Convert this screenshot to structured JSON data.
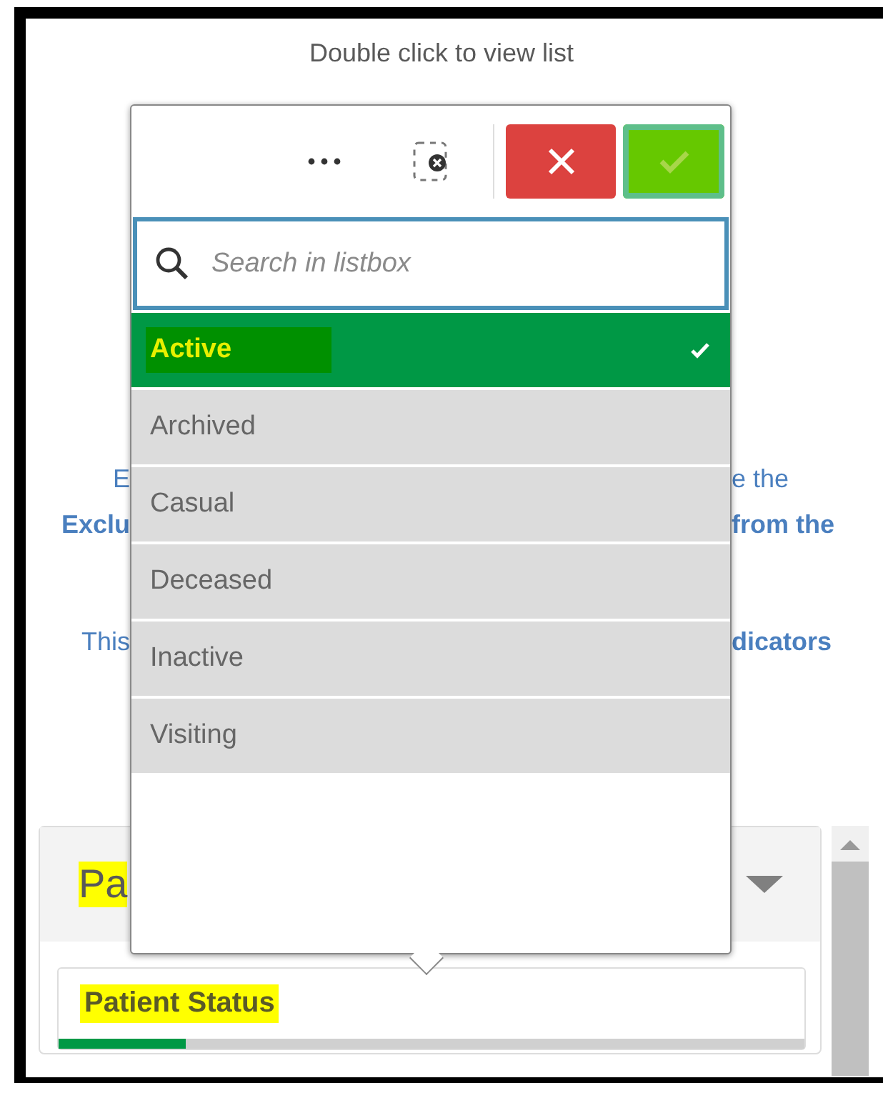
{
  "hint": "Double click to view list",
  "description_lines": [
    {
      "left": {
        "text": "E",
        "bold": false
      },
      "right": {
        "text": "e the",
        "bold": false
      }
    },
    {
      "left": {
        "text": "Exclu",
        "bold": true
      },
      "right": {
        "text": "from the",
        "bold": true
      }
    },
    {
      "left": {
        "text": "This",
        "bold": false
      },
      "right": {
        "text": "dicators",
        "bold": true
      }
    }
  ],
  "filter_panel": {
    "header": "Pa",
    "header_highlighted": true,
    "expanded": false,
    "pane": {
      "title": "Patient Status",
      "title_highlighted": true,
      "level": 0.17
    }
  },
  "listbox": {
    "search": {
      "placeholder": "Search in listbox"
    },
    "confirm_highlighted": true,
    "items": [
      {
        "label": "Active",
        "selected": true,
        "highlighted": true
      },
      {
        "label": "Archived",
        "selected": false,
        "highlighted": false
      },
      {
        "label": "Casual",
        "selected": false,
        "highlighted": false
      },
      {
        "label": "Deceased",
        "selected": false,
        "highlighted": false
      },
      {
        "label": "Inactive",
        "selected": false,
        "highlighted": false
      },
      {
        "label": "Visiting",
        "selected": false,
        "highlighted": false
      }
    ]
  }
}
